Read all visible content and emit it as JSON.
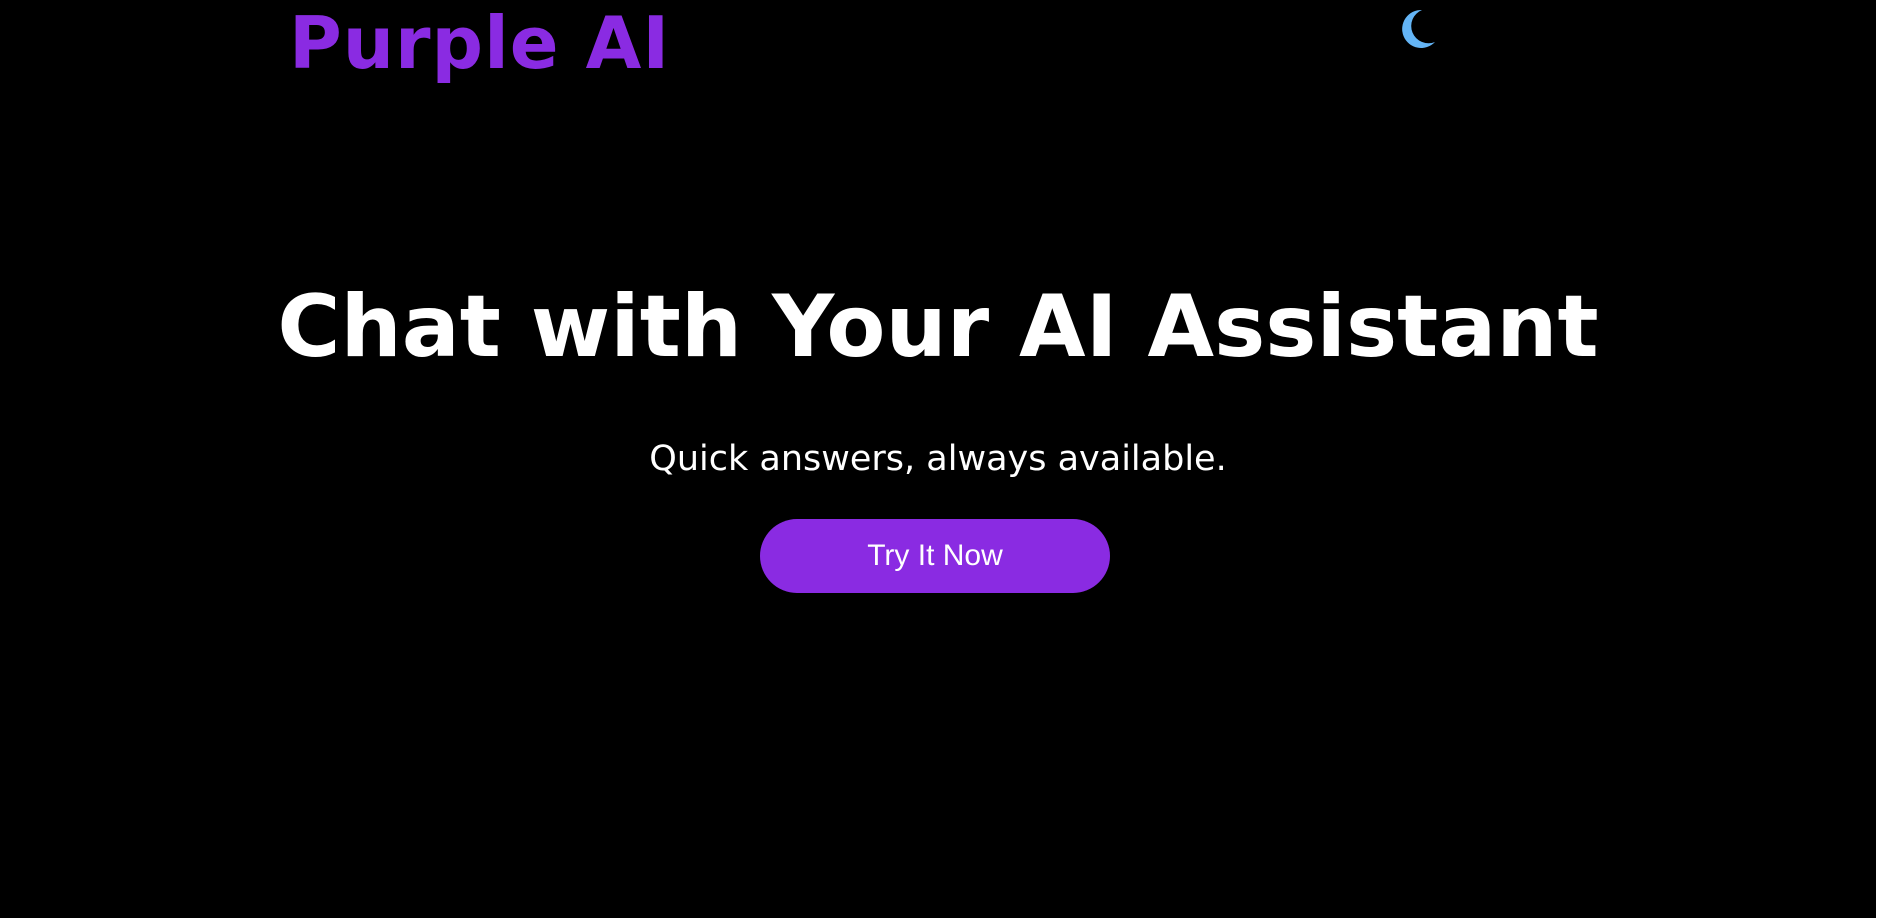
{
  "header": {
    "logo_text": "Purple AI",
    "theme_toggle_icon": "moon-icon"
  },
  "hero": {
    "title": "Chat with Your AI Assistant",
    "subtitle": "Quick answers, always available.",
    "cta_label": "Try It Now"
  },
  "colors": {
    "background": "#000000",
    "brand_purple": "#8a2be2",
    "moon_blue": "#64b5f6",
    "text": "#ffffff"
  }
}
